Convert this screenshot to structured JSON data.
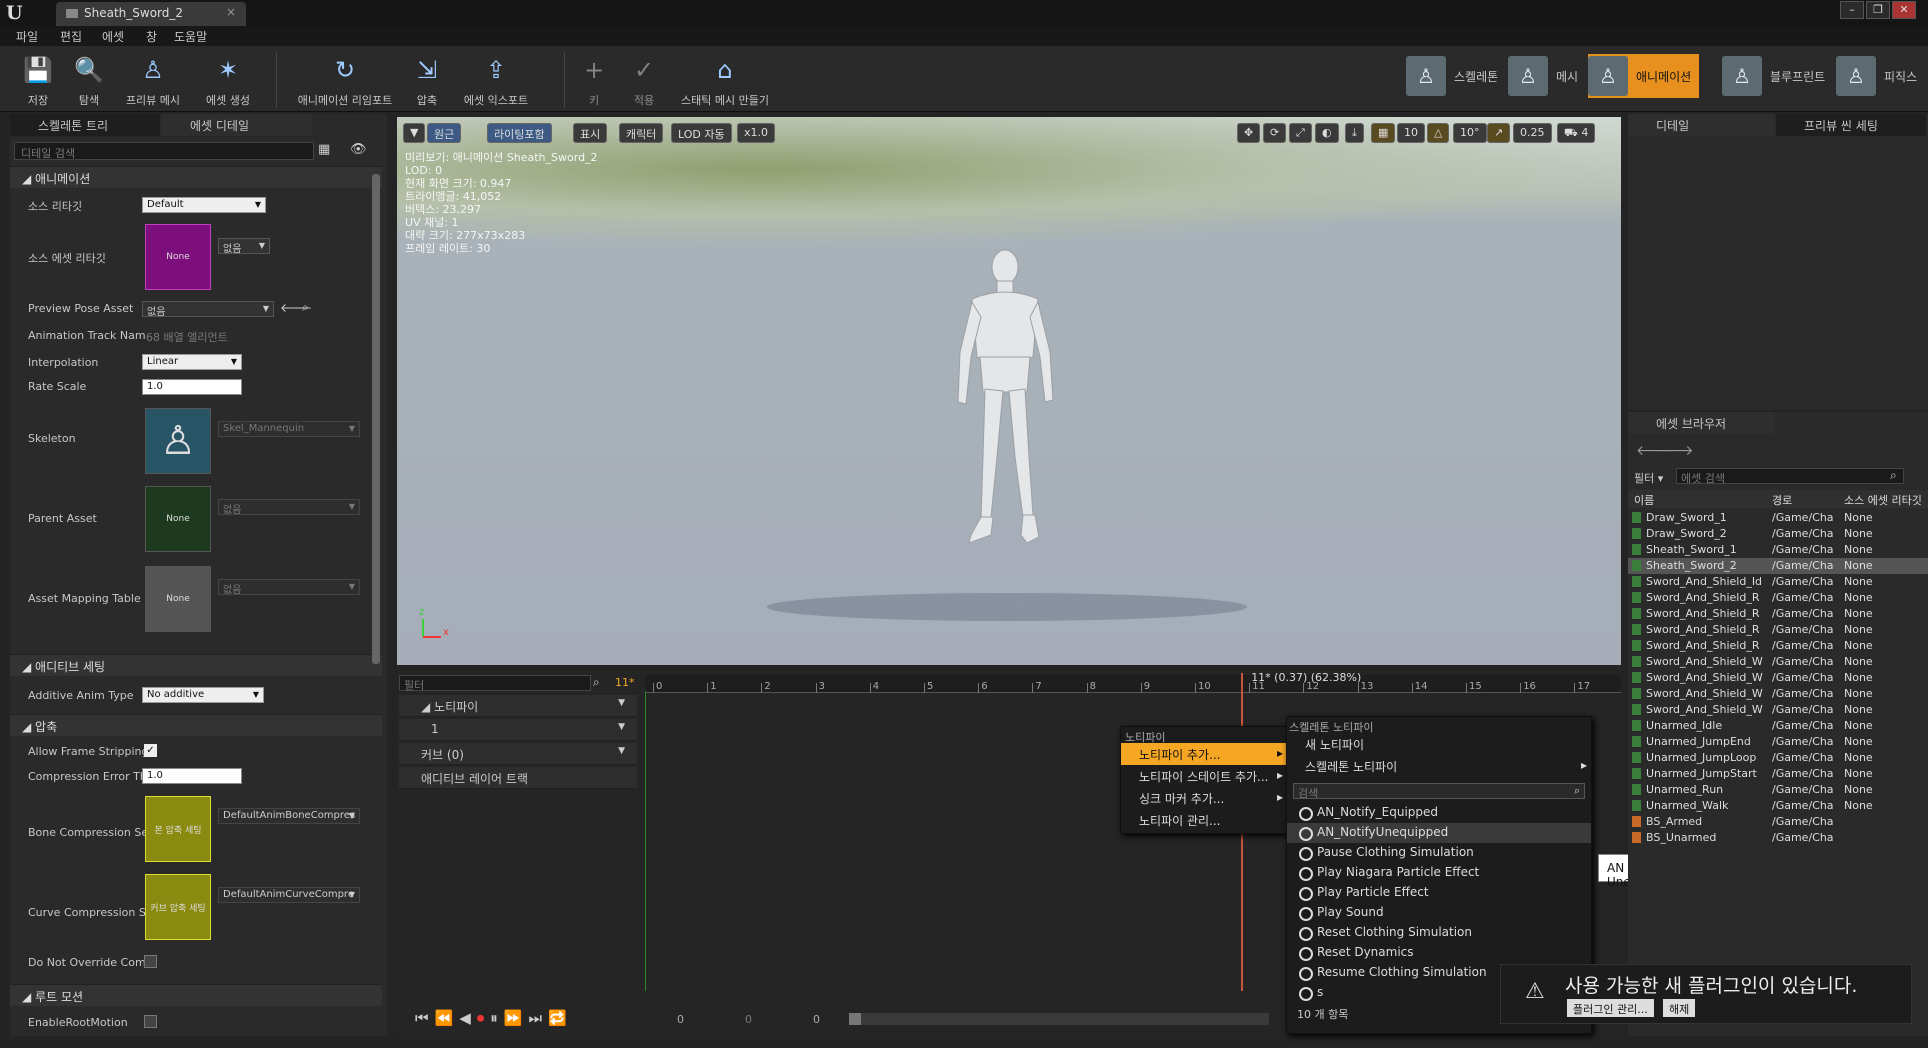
{
  "window": {
    "tab_title": "Sheath_Sword_2",
    "close_glyph": "×"
  },
  "menu": [
    "파일",
    "편집",
    "에셋",
    "창",
    "도움말"
  ],
  "toolbar": {
    "buttons": [
      {
        "label": "저장",
        "icon": "save-icon"
      },
      {
        "label": "탐색",
        "icon": "search-icon"
      },
      {
        "label": "프리뷰 메시",
        "icon": "mesh-icon"
      },
      {
        "label": "에셋 생성",
        "icon": "create-asset-icon"
      },
      {
        "label": "애니메이션 리임포트",
        "icon": "reimport-icon"
      },
      {
        "label": "압축",
        "icon": "compress-icon"
      },
      {
        "label": "에셋 익스포트",
        "icon": "export-icon"
      },
      {
        "label": "키",
        "icon": "plus-icon"
      },
      {
        "label": "적용",
        "icon": "check-icon"
      },
      {
        "label": "스태틱 메시 만들기",
        "icon": "static-mesh-icon"
      }
    ],
    "modes": [
      {
        "label": "스켈레톤",
        "active": false
      },
      {
        "label": "메시",
        "active": false
      },
      {
        "label": "애니메이션",
        "active": true
      },
      {
        "label": "블루프린트",
        "active": false
      },
      {
        "label": "피직스",
        "active": false
      }
    ]
  },
  "left_panel": {
    "tabs": [
      "스켈레톤 트리",
      "에셋 디테일"
    ],
    "search_placeholder": "디테일 검색",
    "sections": {
      "animation": "애니메이션",
      "additive": "애디티브 세팅",
      "compression": "압축",
      "root_motion": "루트 모션"
    },
    "props": {
      "source_retarget": {
        "label": "소스 리타깃",
        "value": "Default"
      },
      "source_asset_retarget": {
        "label": "소스 에셋 리타깃",
        "thumb": "None",
        "value": "없음"
      },
      "preview_pose": {
        "label": "Preview Pose Asset",
        "value": "없음"
      },
      "track_names": {
        "label": "Animation Track Nam",
        "value": "68 배열 엘리먼트"
      },
      "interpolation": {
        "label": "Interpolation",
        "value": "Linear"
      },
      "rate_scale": {
        "label": "Rate Scale",
        "value": "1.0"
      },
      "skeleton": {
        "label": "Skeleton",
        "value": "Skel_Mannequin"
      },
      "parent_asset": {
        "label": "Parent Asset",
        "thumb": "None",
        "value": "없음"
      },
      "mapping_table": {
        "label": "Asset Mapping Table",
        "thumb": "None",
        "value": "없음"
      },
      "additive_type": {
        "label": "Additive Anim Type",
        "value": "No additive"
      },
      "allow_strip": {
        "label": "Allow Frame Stripping",
        "checked": true
      },
      "comp_error": {
        "label": "Compression Error Th",
        "value": "1.0"
      },
      "bone_comp": {
        "label": "Bone Compression Se",
        "thumb": "본 압축 세팅",
        "value": "DefaultAnimBoneCompres"
      },
      "curve_comp": {
        "label": "Curve Compression S",
        "thumb": "커브 압축 세팅",
        "value": "DefaultAnimCurveCompre"
      },
      "no_override": {
        "label": "Do Not Override Com",
        "checked": false
      },
      "enable_root": {
        "label": "EnableRootMotion",
        "checked": false
      }
    }
  },
  "viewport": {
    "buttons": [
      "원근",
      "라이팅포함",
      "표시",
      "캐릭터",
      "LOD 자동",
      "x1.0"
    ],
    "right_values": [
      "10",
      "10°",
      "0.25",
      "4"
    ],
    "info": [
      "미리보기: 애니메이션 Sheath_Sword_2",
      "LOD: 0",
      "현재 화면 크기: 0.947",
      "트라이앵글: 41,052",
      "버텍스: 23,297",
      "UV 채널: 1",
      "대략 크기: 277x73x283",
      "프레임 레이트: 30"
    ]
  },
  "timeline": {
    "filter_placeholder": "필터",
    "frame_badge": "11*",
    "tracks": [
      "노티파이",
      "1",
      "커브 (0)",
      "애디티브 레이어 트랙"
    ],
    "ruler_labels": [
      "0",
      "1",
      "2",
      "3",
      "4",
      "5",
      "6",
      "7",
      "8",
      "9",
      "10",
      "11",
      "12",
      "13",
      "14",
      "15",
      "16",
      "17"
    ],
    "playhead_label": "11* (0.37) (62.38%)",
    "playhead_frame": 11,
    "frame_fields": [
      "0",
      "0",
      "0"
    ]
  },
  "context_menu": {
    "header": "노티파이",
    "items": [
      "노티파이 추가...",
      "노티파이 스테이트 추가...",
      "싱크 마커 추가...",
      "노티파이 관리..."
    ],
    "selected": 0
  },
  "submenu": {
    "header": "스켈레톤 노티파이",
    "items": [
      "새 노티파이",
      "스켈레톤 노티파이"
    ],
    "search_placeholder": "검색",
    "notifies": [
      "AN_Notify_Equipped",
      "AN_NotifyUnequipped",
      "Pause Clothing Simulation",
      "Play Niagara Particle Effect",
      "Play Particle Effect",
      "Play Sound",
      "Reset Clothing Simulation",
      "Reset Dynamics",
      "Resume Clothing Simulation",
      "s"
    ],
    "highlighted": 1,
    "count": "10 개 항목"
  },
  "tooltip": "AN Notify Unequipped",
  "right_panel": {
    "tabs": [
      "디테일",
      "프리뷰 씬 세팅"
    ],
    "browser_tab": "에셋 브라우저",
    "filter_label": "필터",
    "search_placeholder": "에셋 검색",
    "columns": [
      "이름",
      "경로",
      "소스 에셋 리타깃"
    ],
    "assets": [
      {
        "name": "Draw_Sword_1",
        "path": "/Game/Cha",
        "src": "None",
        "type": "anim"
      },
      {
        "name": "Draw_Sword_2",
        "path": "/Game/Cha",
        "src": "None",
        "type": "anim"
      },
      {
        "name": "Sheath_Sword_1",
        "path": "/Game/Cha",
        "src": "None",
        "type": "anim"
      },
      {
        "name": "Sheath_Sword_2",
        "path": "/Game/Cha",
        "src": "None",
        "type": "anim",
        "selected": true
      },
      {
        "name": "Sword_And_Shield_Id",
        "path": "/Game/Cha",
        "src": "None",
        "type": "anim"
      },
      {
        "name": "Sword_And_Shield_R",
        "path": "/Game/Cha",
        "src": "None",
        "type": "anim"
      },
      {
        "name": "Sword_And_Shield_R",
        "path": "/Game/Cha",
        "src": "None",
        "type": "anim"
      },
      {
        "name": "Sword_And_Shield_R",
        "path": "/Game/Cha",
        "src": "None",
        "type": "anim"
      },
      {
        "name": "Sword_And_Shield_R",
        "path": "/Game/Cha",
        "src": "None",
        "type": "anim"
      },
      {
        "name": "Sword_And_Shield_W",
        "path": "/Game/Cha",
        "src": "None",
        "type": "anim"
      },
      {
        "name": "Sword_And_Shield_W",
        "path": "/Game/Cha",
        "src": "None",
        "type": "anim"
      },
      {
        "name": "Sword_And_Shield_W",
        "path": "/Game/Cha",
        "src": "None",
        "type": "anim"
      },
      {
        "name": "Sword_And_Shield_W",
        "path": "/Game/Cha",
        "src": "None",
        "type": "anim"
      },
      {
        "name": "Unarmed_Idle",
        "path": "/Game/Cha",
        "src": "None",
        "type": "anim"
      },
      {
        "name": "Unarmed_JumpEnd",
        "path": "/Game/Cha",
        "src": "None",
        "type": "anim"
      },
      {
        "name": "Unarmed_JumpLoop",
        "path": "/Game/Cha",
        "src": "None",
        "type": "anim"
      },
      {
        "name": "Unarmed_JumpStart",
        "path": "/Game/Cha",
        "src": "None",
        "type": "anim"
      },
      {
        "name": "Unarmed_Run",
        "path": "/Game/Cha",
        "src": "None",
        "type": "anim"
      },
      {
        "name": "Unarmed_Walk",
        "path": "/Game/Cha",
        "src": "None",
        "type": "anim"
      },
      {
        "name": "BS_Armed",
        "path": "/Game/Cha",
        "src": "",
        "type": "blend"
      },
      {
        "name": "BS_Unarmed",
        "path": "/Game/Cha",
        "src": "",
        "type": "blend"
      }
    ]
  },
  "plugin_toast": {
    "message": "사용 가능한 새 플러그인이 있습니다.",
    "manage": "플러그인 관리...",
    "dismiss": "해제"
  },
  "colors": {
    "accent": "#f5a623",
    "anim_icon": "#3b7d3b",
    "blend_icon": "#c86a2a",
    "selected_mode": "#e8901e"
  }
}
